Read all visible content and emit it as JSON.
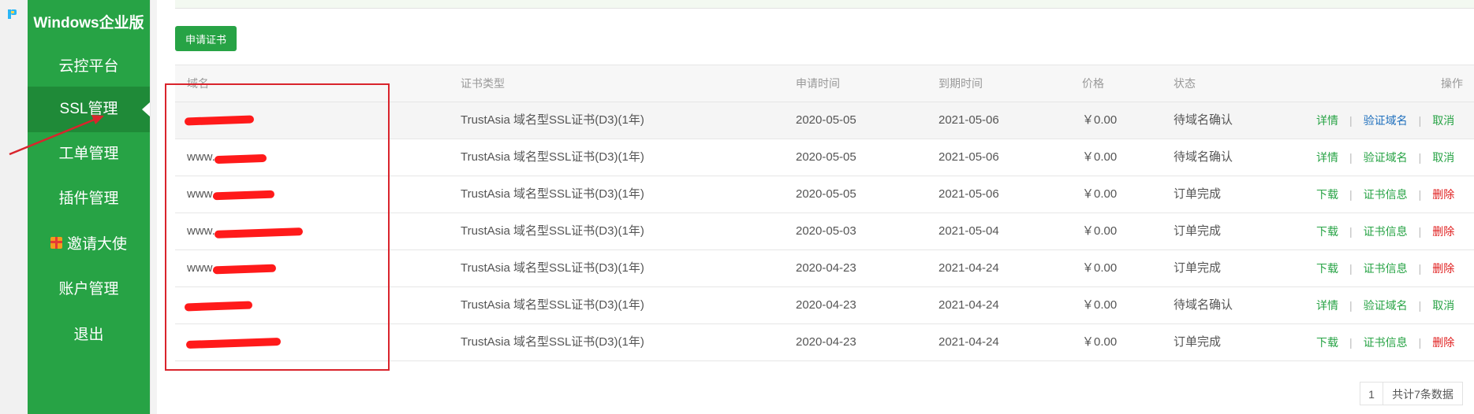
{
  "sidebar": {
    "title": "Windows企业版",
    "items": [
      {
        "label": "云控平台"
      },
      {
        "label": "SSL管理"
      },
      {
        "label": "工单管理"
      },
      {
        "label": "插件管理"
      },
      {
        "label": "邀请大使"
      },
      {
        "label": "账户管理"
      },
      {
        "label": "退出"
      }
    ],
    "active": "SSL管理"
  },
  "toolbar": {
    "apply_label": "申请证书"
  },
  "table": {
    "headers": {
      "domain": "域名",
      "type": "证书类型",
      "apply_time": "申请时间",
      "expire_time": "到期时间",
      "price": "价格",
      "status": "状态",
      "actions": "操作"
    },
    "rows": [
      {
        "domain": "",
        "type": "TrustAsia 域名型SSL证书(D3)(1年)",
        "apply_time": "2020-05-05",
        "expire_time": "2021-05-06",
        "price": "￥0.00",
        "status": "待域名确认",
        "actions": [
          "详情",
          "验证域名",
          "取消"
        ]
      },
      {
        "domain": "www.",
        "type": "TrustAsia 域名型SSL证书(D3)(1年)",
        "apply_time": "2020-05-05",
        "expire_time": "2021-05-06",
        "price": "￥0.00",
        "status": "待域名确认",
        "actions": [
          "详情",
          "验证域名",
          "取消"
        ]
      },
      {
        "domain": "www.",
        "type": "TrustAsia 域名型SSL证书(D3)(1年)",
        "apply_time": "2020-05-05",
        "expire_time": "2021-05-06",
        "price": "￥0.00",
        "status": "订单完成",
        "actions": [
          "下载",
          "证书信息",
          "删除"
        ]
      },
      {
        "domain": "www.",
        "type": "TrustAsia 域名型SSL证书(D3)(1年)",
        "apply_time": "2020-05-03",
        "expire_time": "2021-05-04",
        "price": "￥0.00",
        "status": "订单完成",
        "actions": [
          "下载",
          "证书信息",
          "删除"
        ]
      },
      {
        "domain": "www.",
        "type": "TrustAsia 域名型SSL证书(D3)(1年)",
        "apply_time": "2020-04-23",
        "expire_time": "2021-04-24",
        "price": "￥0.00",
        "status": "订单完成",
        "actions": [
          "下载",
          "证书信息",
          "删除"
        ]
      },
      {
        "domain": "",
        "type": "TrustAsia 域名型SSL证书(D3)(1年)",
        "apply_time": "2020-04-23",
        "expire_time": "2021-04-24",
        "price": "￥0.00",
        "status": "待域名确认",
        "actions": [
          "详情",
          "验证域名",
          "取消"
        ]
      },
      {
        "domain": "",
        "type": "TrustAsia 域名型SSL证书(D3)(1年)",
        "apply_time": "2020-04-23",
        "expire_time": "2021-04-24",
        "price": "￥0.00",
        "status": "订单完成",
        "actions": [
          "下载",
          "证书信息",
          "删除"
        ]
      }
    ]
  },
  "pagination": {
    "page": "1",
    "total": "共计7条数据"
  },
  "colors": {
    "brand": "#27a345",
    "link_blue": "#1e6fbd",
    "danger": "#e02020",
    "annotation": "#d9242c"
  }
}
